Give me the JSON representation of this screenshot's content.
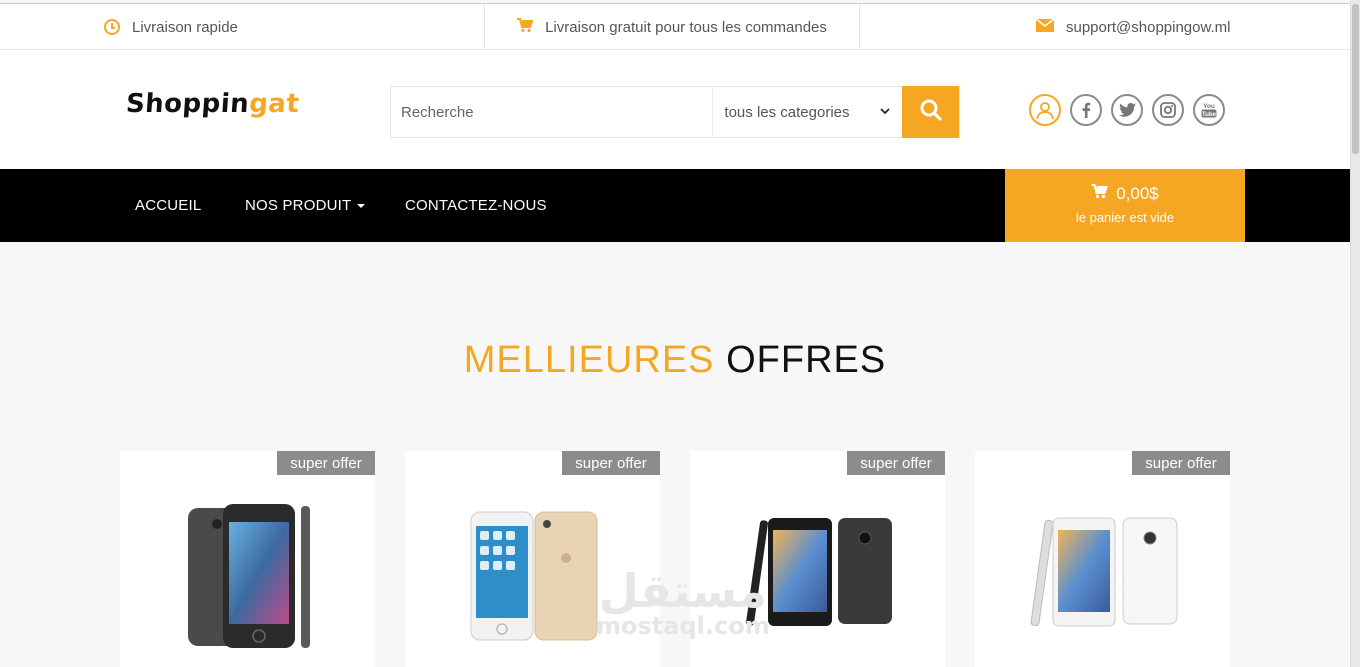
{
  "topbar": {
    "delivery_fast": "Livraison rapide",
    "free_delivery": "Livraison gratuit pour tous les commandes",
    "support_email": "support@shoppingow.ml"
  },
  "header": {
    "logo_part1": "Shoppin",
    "logo_part2": "gat",
    "search_placeholder": "Recherche",
    "category_select": "tous les categories",
    "social_icons": [
      "user-icon",
      "facebook-icon",
      "twitter-icon",
      "instagram-icon",
      "youtube-icon"
    ]
  },
  "nav": {
    "home": "ACCUEIL",
    "products": "NOS PRODUIT",
    "contact": "CONTACTEZ-NOUS"
  },
  "cart": {
    "amount": "0,00$",
    "status": "le panier est vide"
  },
  "section": {
    "title_part1": "MELLIEURES",
    "title_part2": "OFFRES"
  },
  "products": [
    {
      "badge": "super offer",
      "image": "iphone-space-gray"
    },
    {
      "badge": "super offer",
      "image": "iphone-gold-white"
    },
    {
      "badge": "super offer",
      "image": "android-phone-black"
    },
    {
      "badge": "super offer",
      "image": "android-phone-white"
    }
  ],
  "watermark": {
    "arabic": "مستقل",
    "latin": "mostaql.com"
  },
  "colors": {
    "accent": "#f5a623",
    "nav_bg": "#000000",
    "badge_bg": "#8c8c8c"
  }
}
